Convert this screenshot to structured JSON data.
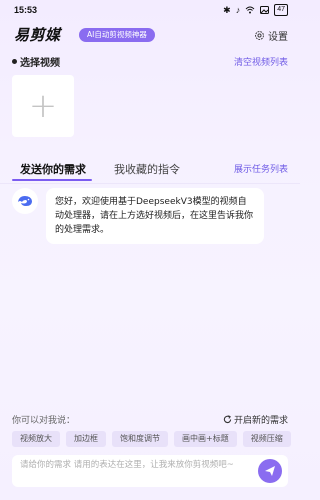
{
  "status_bar": {
    "time": "15:53",
    "battery": "47"
  },
  "header": {
    "app_name": "易剪媒",
    "tagline": "AI自动剪视频神器",
    "settings_label": "设置"
  },
  "video_section": {
    "title": "选择视频",
    "clear_link": "清空视频列表"
  },
  "tabs": {
    "items": [
      {
        "label": "发送你的需求"
      },
      {
        "label": "我收藏的指令"
      }
    ],
    "show_tasks_link": "展示任务列表"
  },
  "chat": {
    "bot_message": "您好，欢迎使用基于DeepseekV3模型的视频自动处理器，请在上方选好视频后，在这里告诉我你的处理需求。"
  },
  "suggestions": {
    "label": "你可以对我说：",
    "restart_label": "开启新的需求",
    "chips": [
      "视频放大",
      "加边框",
      "饱和度调节",
      "画中画+标题",
      "视频压缩"
    ]
  },
  "input": {
    "placeholder": "请给你的需求 请用的表达在这里，让我来放你剪视频吧~"
  },
  "colors": {
    "accent": "#8a6cf0",
    "link": "#6f5be6"
  }
}
